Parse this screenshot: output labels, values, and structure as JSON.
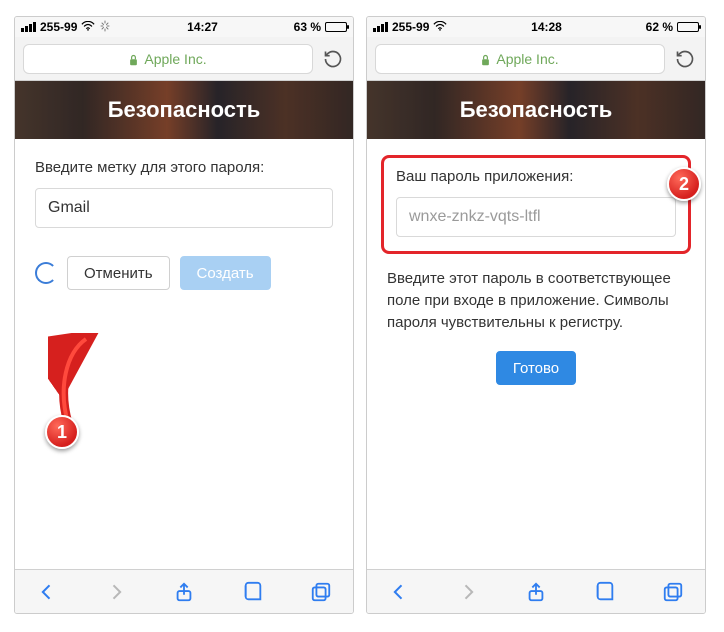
{
  "screens": {
    "left": {
      "status": {
        "carrier": "255-99",
        "time": "14:27",
        "battery_pct": "63 %"
      },
      "url": {
        "host": "Apple Inc."
      },
      "hero_title": "Безопасность",
      "form": {
        "label": "Введите метку для этого пароля:",
        "input_value": "Gmail",
        "cancel_label": "Отменить",
        "create_label": "Создать"
      },
      "callout_num": "1"
    },
    "right": {
      "status": {
        "carrier": "255-99",
        "time": "14:28",
        "battery_pct": "62 %"
      },
      "url": {
        "host": "Apple Inc."
      },
      "hero_title": "Безопасность",
      "result": {
        "label": "Ваш пароль приложения:",
        "password": "wnxe-znkz-vqts-ltfl",
        "instructions": "Введите этот пароль в соответствующее поле при входе в приложение. Символы пароля чувствительны к регистру.",
        "done_label": "Готово"
      },
      "callout_num": "2"
    }
  }
}
